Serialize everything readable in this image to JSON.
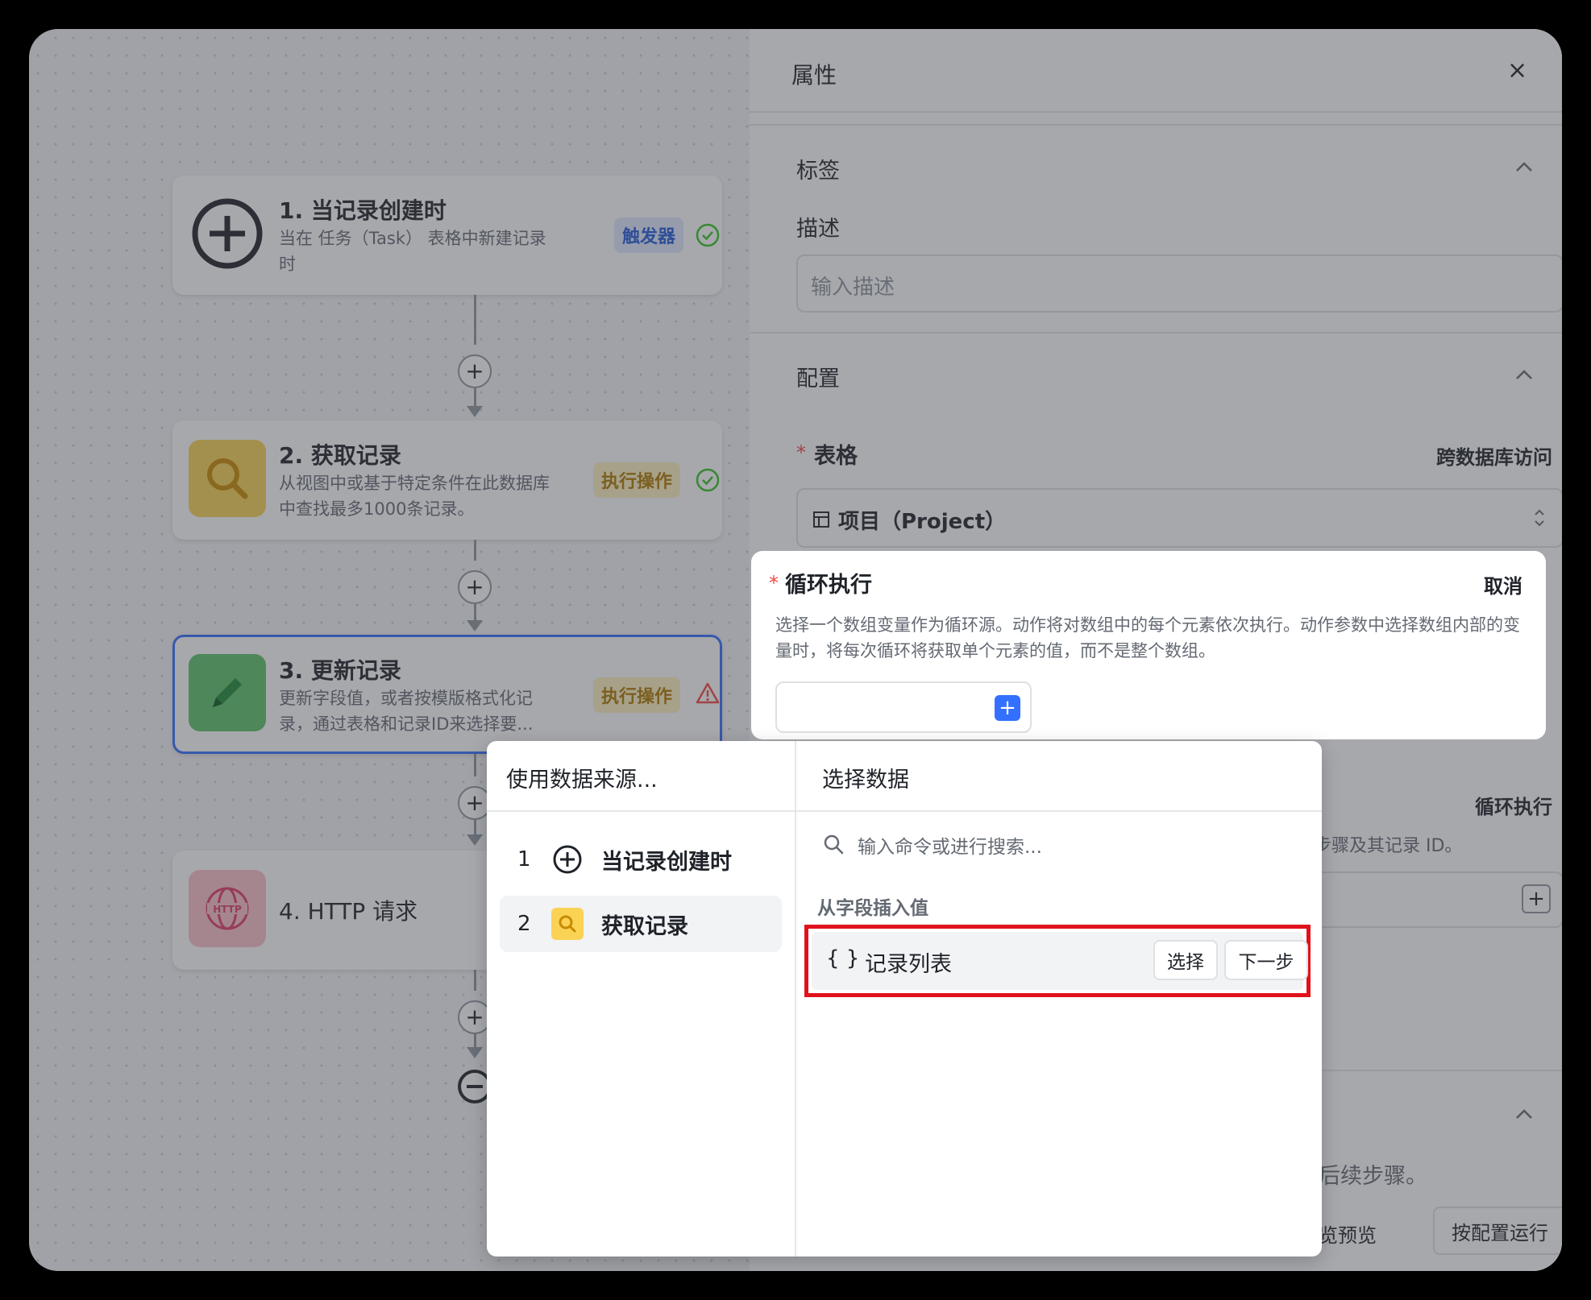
{
  "flow": {
    "nodes": [
      {
        "title": "1. 当记录创建时",
        "desc": "当在 任务（Task） 表格中新建记录时",
        "badge": "触发器",
        "icon": "plus-circle-icon",
        "status": "success"
      },
      {
        "title": "2. 获取记录",
        "desc": "从视图中或基于特定条件在此数据库中查找最多1000条记录。",
        "badge": "执行操作",
        "icon": "search-icon",
        "status": "success"
      },
      {
        "title": "3. 更新记录",
        "desc": "更新字段值，或者按模版格式化记录，通过表格和记录ID来选择要...",
        "badge": "执行操作",
        "icon": "pencil-icon",
        "status": "warning"
      },
      {
        "title": "4. HTTP 请求",
        "icon": "http-globe-icon"
      }
    ],
    "add_step": "+"
  },
  "panel": {
    "title": "属性",
    "close": "×",
    "sections": {
      "label": {
        "title": "标签",
        "desc_label": "描述",
        "desc_placeholder": "输入描述"
      },
      "config": {
        "title": "配置",
        "table_label": "表格",
        "required_mark": "*",
        "cross_db": "跨数据库访问",
        "table_value": "项目（Project）",
        "loop_right": "循环执行",
        "hint_fragment": "步骤及其记录 ID。"
      },
      "bottom": {
        "hint_fragment": "后续步骤。",
        "preview_fragment": "览预览",
        "run_button": "按配置运行"
      }
    }
  },
  "loop_card": {
    "title": "循环执行",
    "cancel": "取消",
    "desc": "选择一个数组变量作为循环源。动作将对数组中的每个元素依次执行。动作参数中选择数组内部的变量时，将每次循环将获取单个元素的值，而不是整个数组。"
  },
  "popover": {
    "source_header": "使用数据来源...",
    "data_header": "选择数据",
    "search_placeholder": "输入命令或进行搜索...",
    "sources": [
      {
        "num": "1",
        "label": "当记录创建时",
        "icon": "plus-circle-icon"
      },
      {
        "num": "2",
        "label": "获取记录",
        "icon": "search-icon"
      }
    ],
    "group_label": "从字段插入值",
    "field": {
      "icon": "{ }",
      "label": "记录列表",
      "select": "选择",
      "next": "下一步"
    }
  },
  "colors": {
    "accent": "#3370ff",
    "highlight": "#e0121c",
    "warning": "#f54a45",
    "success": "#34c724"
  }
}
